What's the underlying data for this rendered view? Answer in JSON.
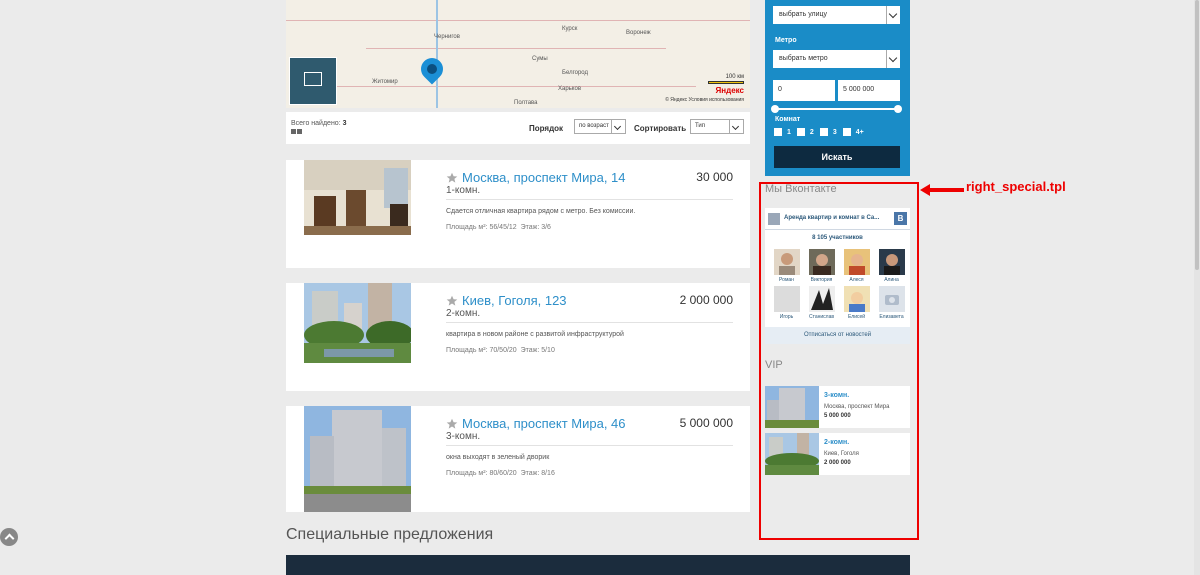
{
  "map": {
    "cities": [
      "Чернигов",
      "Курск",
      "Воронеж",
      "Житомир",
      "Сумы",
      "Белгород",
      "Харьков",
      "Полтава"
    ],
    "scale": "100 км",
    "brand": "Яндекс",
    "copyright": "© Яндекс  Условия использования"
  },
  "results": {
    "found_label": "Всего найдено:",
    "found_count": "3",
    "order_label": "Порядок",
    "order_value": "по возраст",
    "sort_label": "Сортировать",
    "sort_value": "Тип"
  },
  "listings": [
    {
      "title": "Москва, проспект Мира, 14",
      "rooms": "1-комн.",
      "price": "30 000",
      "desc": "Сдается отличная квартира рядом с метро. Без комиссии.",
      "area": "Площадь м²: 56/45/12",
      "floor": "Этаж: 3/6"
    },
    {
      "title": "Киев, Гоголя, 123",
      "rooms": "2-комн.",
      "price": "2 000 000",
      "desc": "квартира в новом районе с развитой инфраструктурой",
      "area": "Площадь м²: 70/50/20",
      "floor": "Этаж: 5/10"
    },
    {
      "title": "Москва, проспект Мира, 46",
      "rooms": "3-комн.",
      "price": "5 000 000",
      "desc": "окна выходят в зеленый дворик",
      "area": "Площадь м²: 80/60/20",
      "floor": "Этаж: 8/16"
    }
  ],
  "special_title": "Специальные предложения",
  "filter": {
    "street_placeholder": "выбрать улицу",
    "metro_label": "Метро",
    "metro_placeholder": "выбрать метро",
    "price_from": "0",
    "price_to": "5 000 000",
    "rooms_label": "Комнат",
    "room_options": [
      "1",
      "2",
      "3",
      "4+"
    ],
    "search_button": "Искать"
  },
  "vk": {
    "section_title": "Мы Вконтакте",
    "group_name": "Аренда квартир и комнат в Са...",
    "badge": "В",
    "members": "8 105 участников",
    "people": [
      "Роман",
      "Виктория",
      "Алеся",
      "Алина",
      "Игорь",
      "Станислав",
      "Елисей",
      "Елизавета"
    ],
    "unsubscribe": "Отписаться от новостей"
  },
  "vip": {
    "section_title": "VIP",
    "items": [
      {
        "title": "3-комн.",
        "address": "Москва, проспект Мира",
        "price": "5 000 000"
      },
      {
        "title": "2-комн.",
        "address": "Киев, Гоголя",
        "price": "2 000 000"
      }
    ]
  },
  "annotation": "right_special.tpl",
  "colors": {
    "accent": "#1a8cc7",
    "link": "#2e8fc9",
    "annotation": "#e00000",
    "button_dark": "#0d2a40"
  }
}
